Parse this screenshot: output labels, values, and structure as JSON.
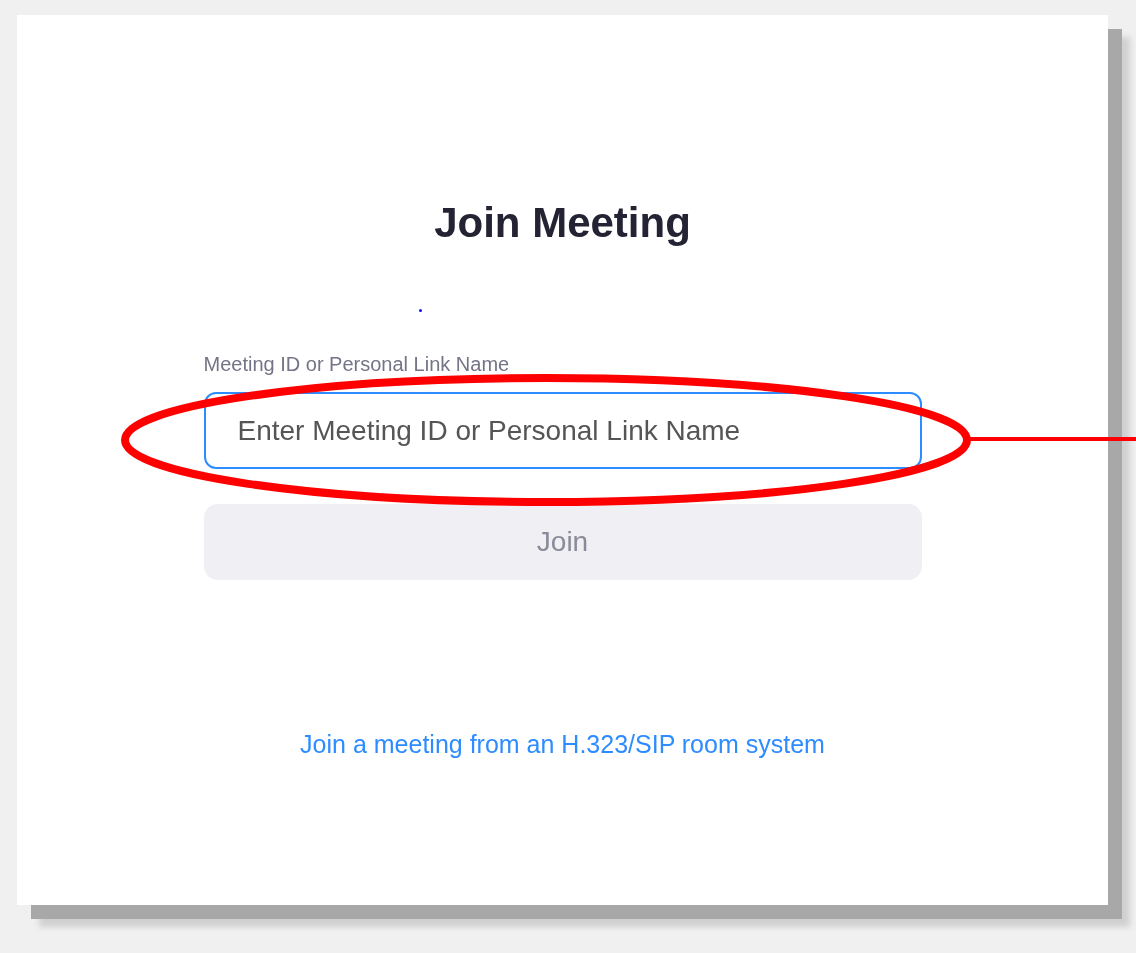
{
  "title": "Join Meeting",
  "field": {
    "label": "Meeting ID or Personal Link Name",
    "placeholder": "Enter Meeting ID or Personal Link Name"
  },
  "join_button": {
    "label": "Join",
    "disabled": true
  },
  "room_link": "Join a meeting from an H.323/SIP room system",
  "annotation": {
    "kind": "callout"
  }
}
